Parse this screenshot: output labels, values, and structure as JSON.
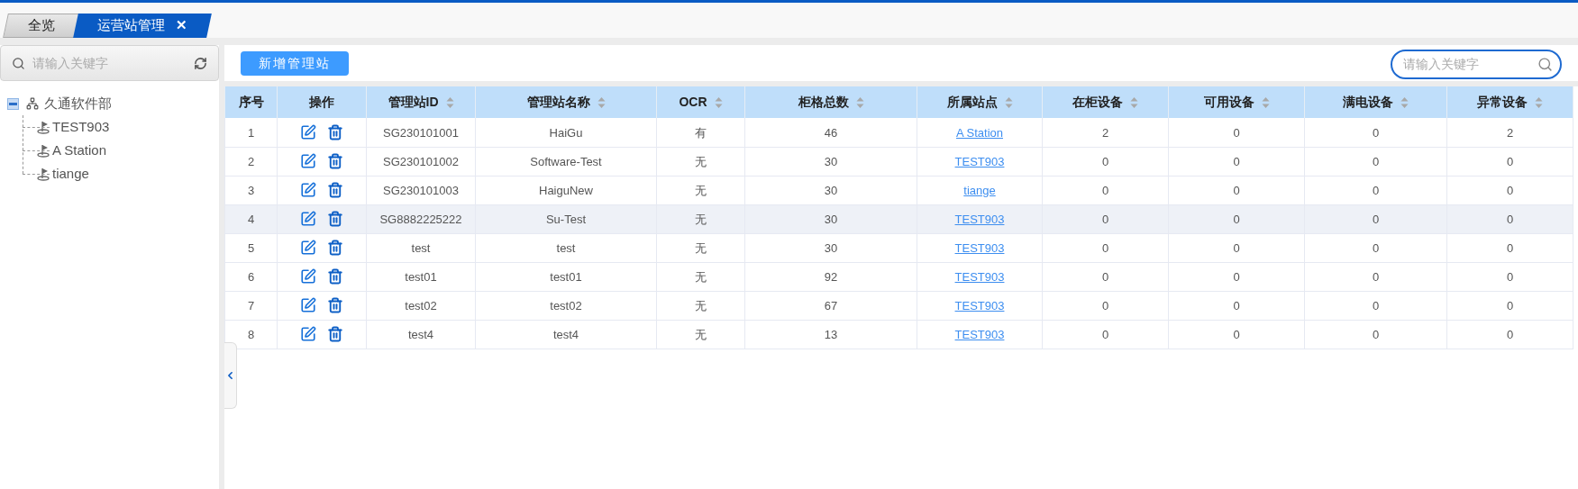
{
  "tabs": [
    {
      "label": "全览",
      "selected": false
    },
    {
      "label": "运营站管理",
      "selected": true,
      "close": "✕"
    }
  ],
  "sidebar": {
    "search": {
      "placeholder": "请输入关键字"
    },
    "tree": [
      {
        "label": "久通软件部",
        "kind": "org",
        "expanded": true,
        "children": [
          {
            "label": "TEST903",
            "kind": "station"
          },
          {
            "label": "A Station",
            "kind": "station"
          },
          {
            "label": "tiange",
            "kind": "station"
          }
        ]
      }
    ]
  },
  "toolbar": {
    "add_button": "新增管理站",
    "search": {
      "placeholder": "请输入关键字"
    }
  },
  "table": {
    "columns": [
      {
        "label": "序号",
        "sortable": false
      },
      {
        "label": "操作",
        "sortable": false
      },
      {
        "label": "管理站ID",
        "sortable": true
      },
      {
        "label": "管理站名称",
        "sortable": true
      },
      {
        "label": "OCR",
        "sortable": true
      },
      {
        "label": "柜格总数",
        "sortable": true
      },
      {
        "label": "所属站点",
        "sortable": true
      },
      {
        "label": "在柜设备",
        "sortable": true
      },
      {
        "label": "可用设备",
        "sortable": true
      },
      {
        "label": "满电设备",
        "sortable": true
      },
      {
        "label": "异常设备",
        "sortable": true
      }
    ],
    "rows": [
      {
        "selected": false,
        "cells": [
          "1",
          "",
          "SG230101001",
          "HaiGu",
          "有",
          "46",
          "A Station",
          "2",
          "0",
          "0",
          "2"
        ]
      },
      {
        "selected": false,
        "cells": [
          "2",
          "",
          "SG230101002",
          "Software-Test",
          "无",
          "30",
          "TEST903",
          "0",
          "0",
          "0",
          "0"
        ]
      },
      {
        "selected": false,
        "cells": [
          "3",
          "",
          "SG230101003",
          "HaiguNew",
          "无",
          "30",
          "tiange",
          "0",
          "0",
          "0",
          "0"
        ]
      },
      {
        "selected": true,
        "cells": [
          "4",
          "",
          "SG8882225222",
          "Su-Test",
          "无",
          "30",
          "TEST903",
          "0",
          "0",
          "0",
          "0"
        ]
      },
      {
        "selected": false,
        "cells": [
          "5",
          "",
          "test",
          "test",
          "无",
          "30",
          "TEST903",
          "0",
          "0",
          "0",
          "0"
        ]
      },
      {
        "selected": false,
        "cells": [
          "6",
          "",
          "test01",
          "test01",
          "无",
          "92",
          "TEST903",
          "0",
          "0",
          "0",
          "0"
        ]
      },
      {
        "selected": false,
        "cells": [
          "7",
          "",
          "test02",
          "test02",
          "无",
          "67",
          "TEST903",
          "0",
          "0",
          "0",
          "0"
        ]
      },
      {
        "selected": false,
        "cells": [
          "8",
          "",
          "test4",
          "test4",
          "无",
          "13",
          "TEST903",
          "0",
          "0",
          "0",
          "0"
        ]
      }
    ]
  }
}
